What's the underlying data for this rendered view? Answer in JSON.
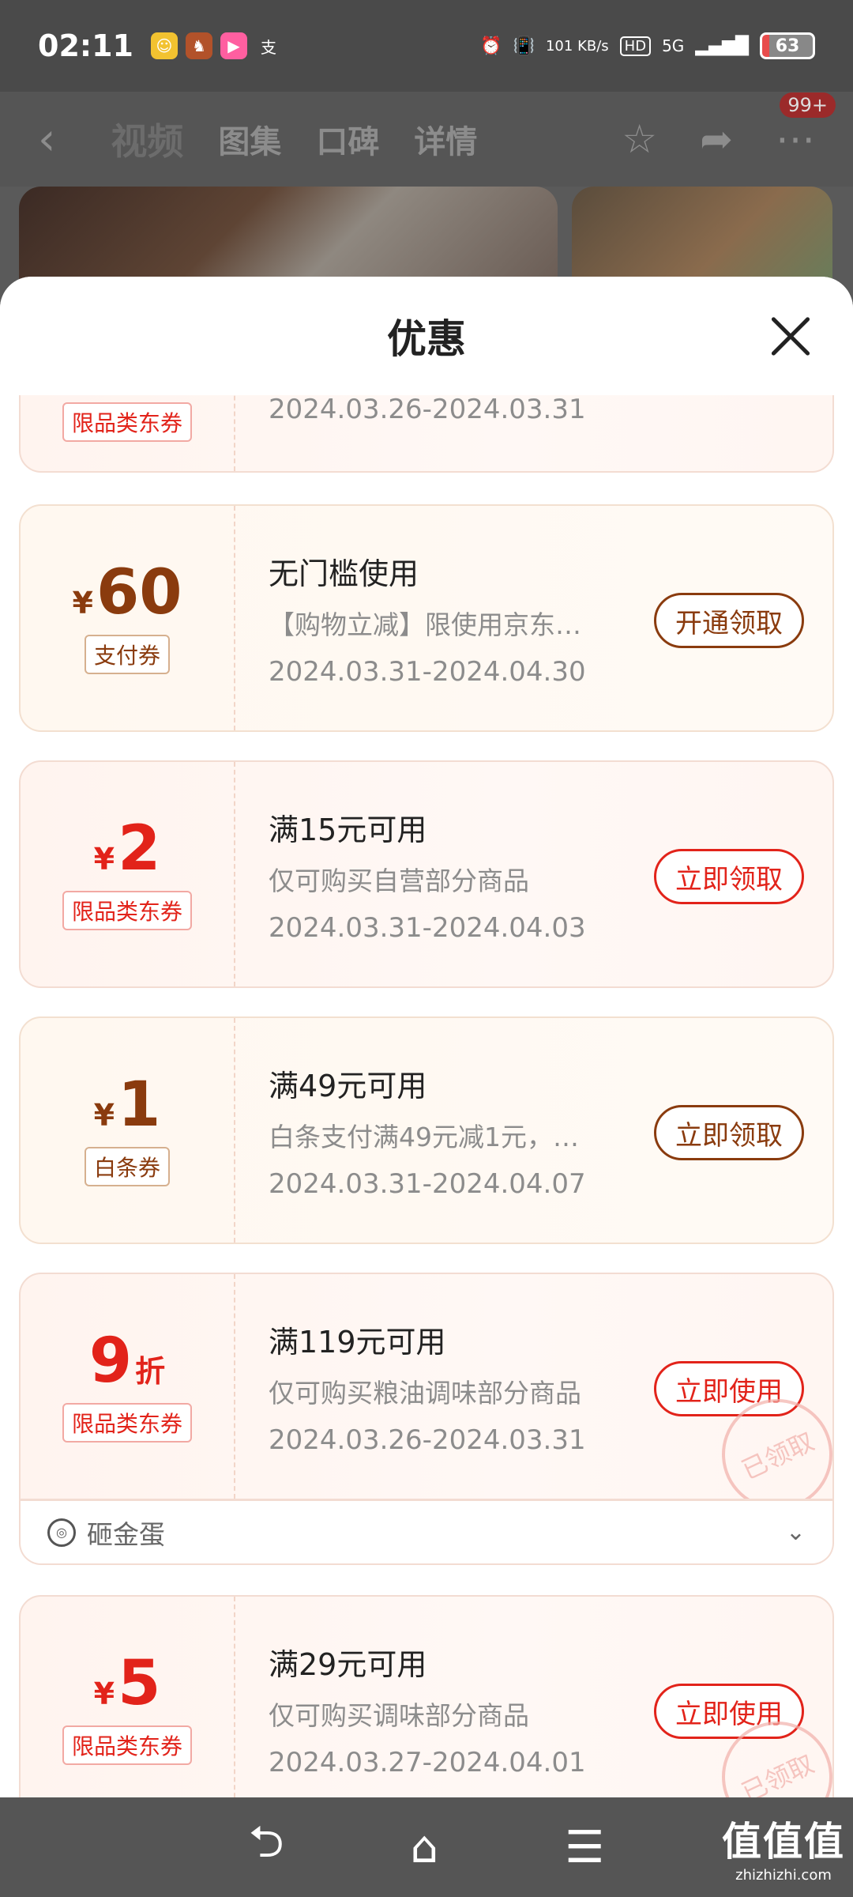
{
  "status_bar": {
    "time": "02:11",
    "net_speed": "101 KB/s",
    "signal": "5G",
    "battery": "63"
  },
  "app_bar": {
    "tabs": [
      "视频",
      "图集",
      "口碑",
      "详情"
    ],
    "badge": "99+"
  },
  "sheet": {
    "title": "优惠"
  },
  "coupons": [
    {
      "amount_num": "",
      "tag": "限品类东券",
      "title": "",
      "desc": "",
      "date": "2024.03.26-2024.03.31",
      "button": ""
    },
    {
      "yen": "¥",
      "amount_num": "60",
      "tag": "支付券",
      "title": "无门槛使用",
      "desc": "【购物立减】限使用京东…",
      "date": "2024.03.31-2024.04.30",
      "button": "开通领取"
    },
    {
      "yen": "¥",
      "amount_num": "2",
      "tag": "限品类东券",
      "title": "满15元可用",
      "desc": "仅可购买自营部分商品",
      "date": "2024.03.31-2024.04.03",
      "button": "立即领取"
    },
    {
      "yen": "¥",
      "amount_num": "1",
      "tag": "白条券",
      "title": "满49元可用",
      "desc": "白条支付满49元减1元，…",
      "date": "2024.03.31-2024.04.07",
      "button": "立即领取"
    },
    {
      "amount_num": "9",
      "unit": "折",
      "tag": "限品类东券",
      "title": "满119元可用",
      "desc": "仅可购买粮油调味部分商品",
      "date": "2024.03.26-2024.03.31",
      "button": "立即使用",
      "stamp": "已领取",
      "subrow": "砸金蛋"
    },
    {
      "yen": "¥",
      "amount_num": "5",
      "tag": "限品类东券",
      "title": "满29元可用",
      "desc": "仅可购买调味部分商品",
      "date": "2024.03.27-2024.04.01",
      "button": "立即使用",
      "stamp": "已领取"
    }
  ],
  "watermark": {
    "main": "值值值",
    "sub": "zhizhizhi.com"
  },
  "colors": {
    "accent_red": "#e2231a",
    "accent_brown": "#8a3b0e"
  }
}
